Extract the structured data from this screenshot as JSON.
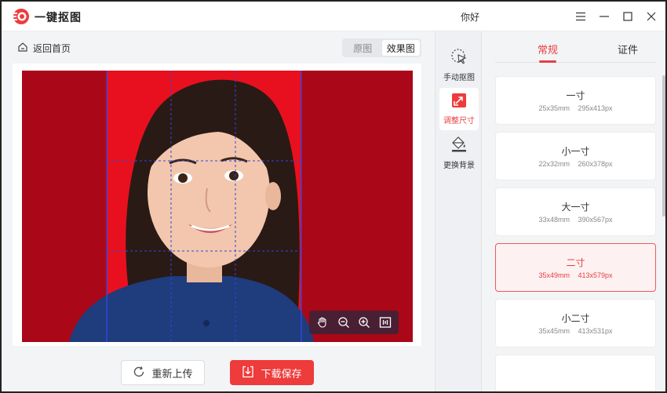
{
  "app": {
    "name": "一键抠图",
    "user": "你好"
  },
  "nav": {
    "back_label": "返回首页"
  },
  "view_toggle": {
    "original": "原图",
    "result": "效果图"
  },
  "actions": {
    "reupload": "重新上传",
    "download": "下载保存"
  },
  "tools": [
    {
      "label": "手动抠图",
      "icon": "cursor-select-icon"
    },
    {
      "label": "调整尺寸",
      "icon": "resize-icon"
    },
    {
      "label": "更换背景",
      "icon": "paint-bucket-icon"
    }
  ],
  "tabs": {
    "general": "常规",
    "certificate": "证件"
  },
  "sizes": [
    {
      "name": "一寸",
      "mm": "25x35mm",
      "px": "295x413px"
    },
    {
      "name": "小一寸",
      "mm": "22x32mm",
      "px": "260x378px"
    },
    {
      "name": "大一寸",
      "mm": "33x48mm",
      "px": "390x567px"
    },
    {
      "name": "二寸",
      "mm": "35x49mm",
      "px": "413x579px",
      "selected": true
    },
    {
      "name": "小二寸",
      "mm": "35x45mm",
      "px": "413x531px"
    }
  ],
  "colors": {
    "accent": "#e84040",
    "background_red": "#e8101f",
    "outside_red": "#aa0718"
  }
}
